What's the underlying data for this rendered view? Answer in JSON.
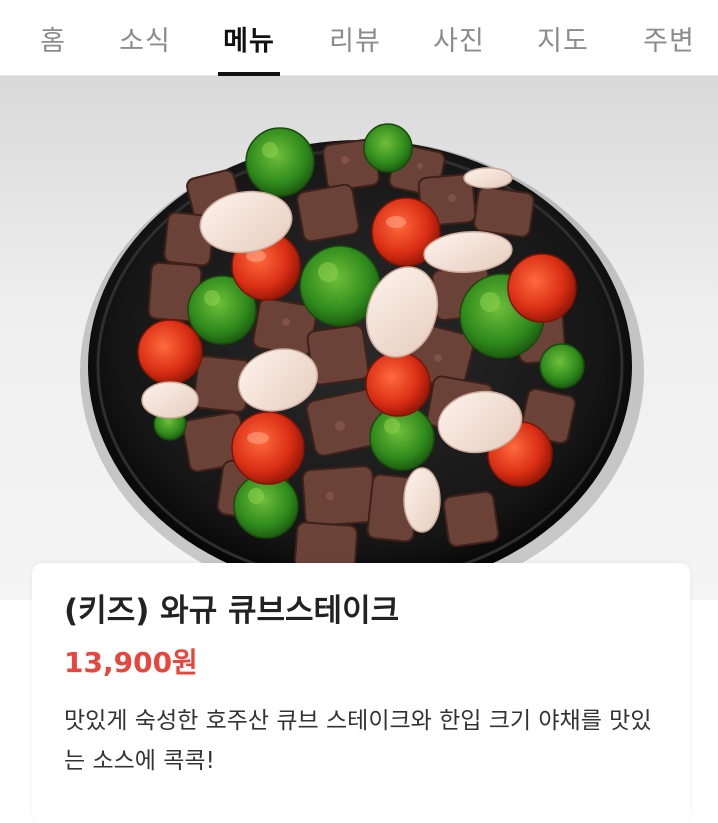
{
  "tabs": [
    {
      "label": "홈",
      "active": false
    },
    {
      "label": "소식",
      "active": false
    },
    {
      "label": "메뉴",
      "active": true
    },
    {
      "label": "리뷰",
      "active": false
    },
    {
      "label": "사진",
      "active": false
    },
    {
      "label": "지도",
      "active": false
    },
    {
      "label": "주변",
      "active": false
    }
  ],
  "menu_item": {
    "title": "(키즈) 와규 큐브스테이크",
    "price": "13,900원",
    "description": "맛있게 숙성한 호주산 큐브 스테이크와 한입 크기 야채를 맛있는 소스에 콕콕!"
  },
  "colors": {
    "active_tab": "#111111",
    "inactive_tab": "#8c8c8c",
    "price": "#e8453c",
    "title": "#222222"
  }
}
